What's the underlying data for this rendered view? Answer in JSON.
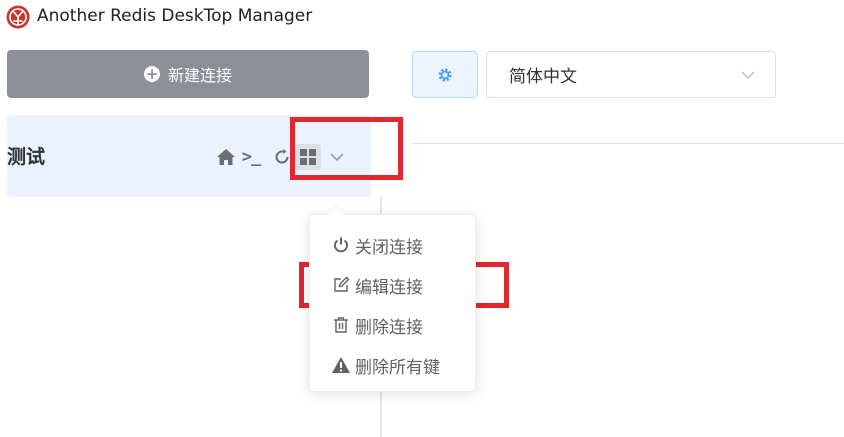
{
  "window": {
    "title": "Another Redis DeskTop Manager"
  },
  "sidebar": {
    "new_connection_label": "新建连接",
    "connections": [
      {
        "name": "测试"
      }
    ],
    "connection_icons": [
      "home-icon",
      "terminal-icon",
      "refresh-icon",
      "grid-icon",
      "chevron-down-icon"
    ]
  },
  "header": {
    "language_selected": "简体中文"
  },
  "dropdown": {
    "items": [
      {
        "label": "关闭连接",
        "icon": "power-icon"
      },
      {
        "label": "编辑连接",
        "icon": "edit-icon"
      },
      {
        "label": "删除连接",
        "icon": "trash-icon"
      },
      {
        "label": "删除所有键",
        "icon": "warning-icon"
      }
    ]
  },
  "colors": {
    "highlight": "#e0282e",
    "sidebar_button": "#8c8f96",
    "selected_row": "#ebf2fd",
    "accent": "#409eff"
  }
}
